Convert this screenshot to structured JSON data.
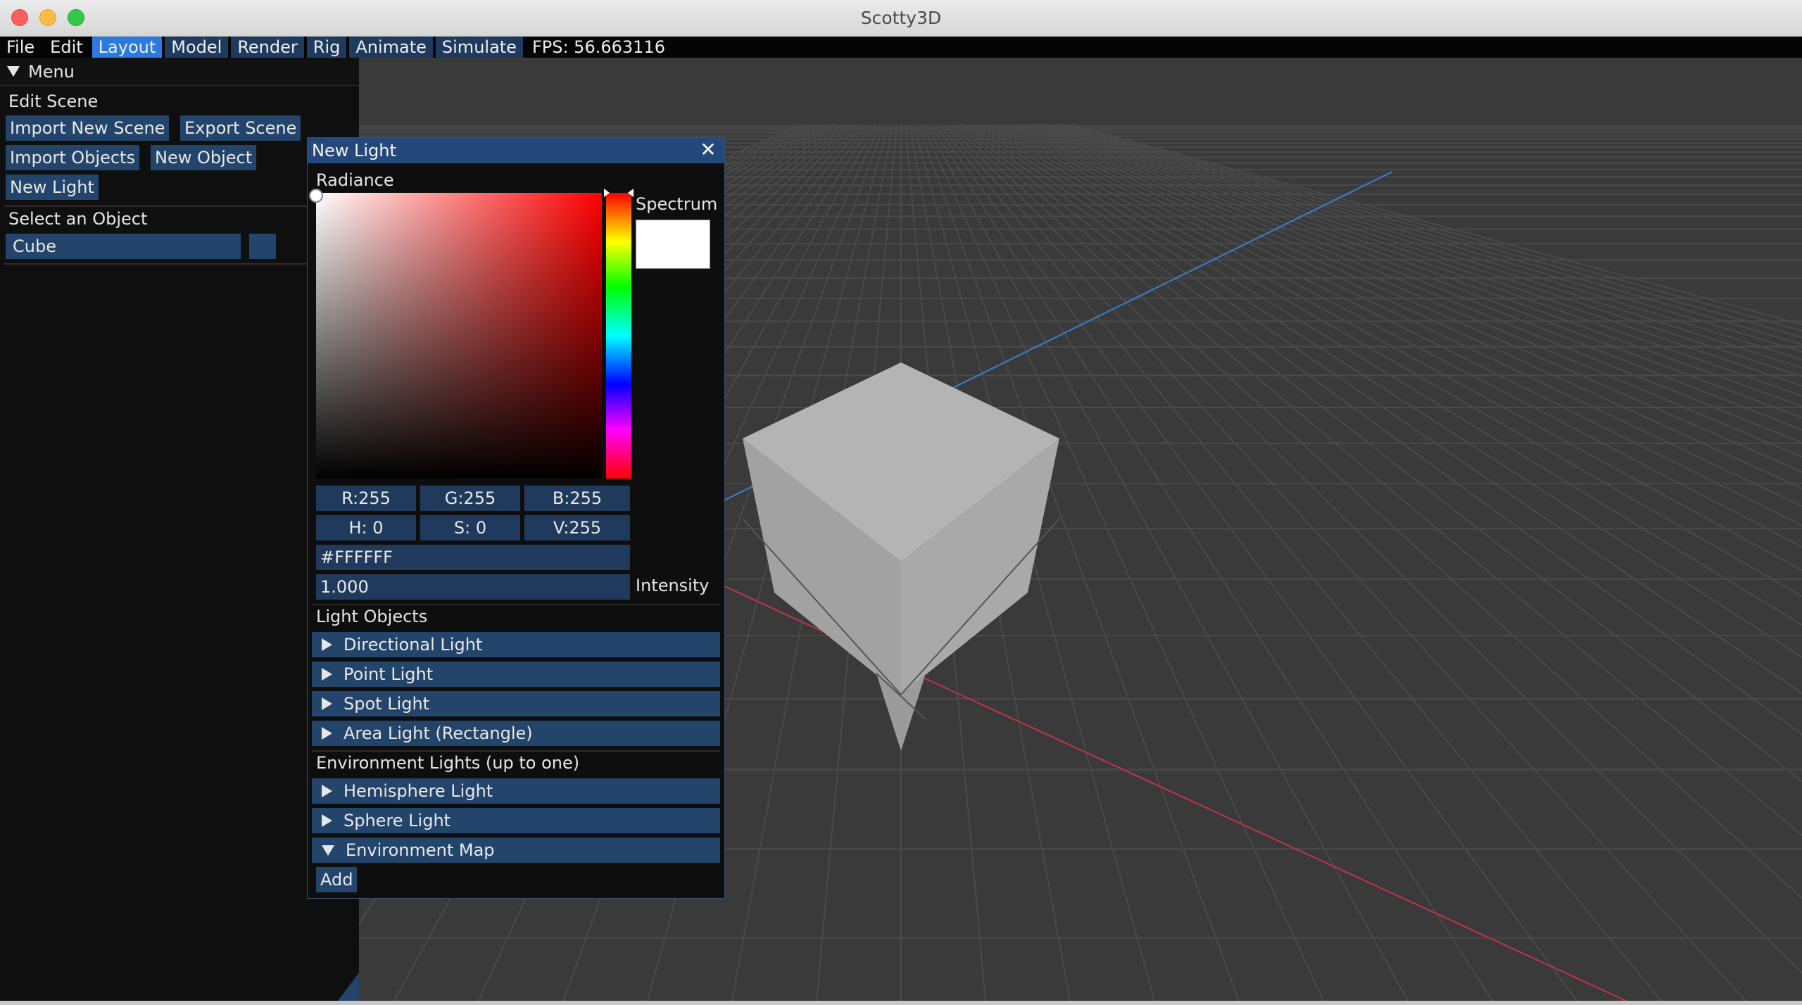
{
  "window": {
    "title": "Scotty3D"
  },
  "menubar": {
    "items": [
      {
        "label": "File",
        "style": "plain"
      },
      {
        "label": "Edit",
        "style": "plain"
      },
      {
        "label": "Layout",
        "style": "active"
      },
      {
        "label": "Model",
        "style": "tab"
      },
      {
        "label": "Render",
        "style": "tab"
      },
      {
        "label": "Rig",
        "style": "tab"
      },
      {
        "label": "Animate",
        "style": "tab"
      },
      {
        "label": "Simulate",
        "style": "tab"
      }
    ],
    "fps": "FPS: 56.663116"
  },
  "leftpanel": {
    "header": "Menu",
    "edit_scene_label": "Edit Scene",
    "buttons": {
      "import_new_scene": "Import New Scene",
      "export_scene": "Export Scene",
      "import_objects": "Import Objects",
      "new_object": "New Object",
      "new_light": "New Light"
    },
    "select_label": "Select an Object",
    "selected_object": "Cube"
  },
  "lightwindow": {
    "title": "New Light",
    "close_glyph": "✕",
    "radiance_label": "Radiance",
    "spectrum_label": "Spectrum",
    "spectrum_color": "#FFFFFF",
    "fields": {
      "r": "R:255",
      "g": "G:255",
      "b": "B:255",
      "h": "H:  0",
      "s": "S:  0",
      "v": "V:255",
      "hex": "#FFFFFF",
      "intensity_value": "1.000"
    },
    "intensity_label": "Intensity",
    "light_objects_label": "Light Objects",
    "light_objects": [
      "Directional Light",
      "Point Light",
      "Spot Light",
      "Area Light (Rectangle)"
    ],
    "environment_label": "Environment Lights (up to one)",
    "environment_items": [
      {
        "label": "Hemisphere Light",
        "expanded": false
      },
      {
        "label": "Sphere Light",
        "expanded": false
      },
      {
        "label": "Environment Map",
        "expanded": true
      }
    ],
    "add_button": "Add"
  },
  "colors": {
    "accent": "#2a7ae0",
    "button": "#23446b",
    "panel": "#0f0f10",
    "viewport": "#3a3a3a",
    "axis_x": "#c0344a",
    "axis_z": "#3a7fd0"
  }
}
